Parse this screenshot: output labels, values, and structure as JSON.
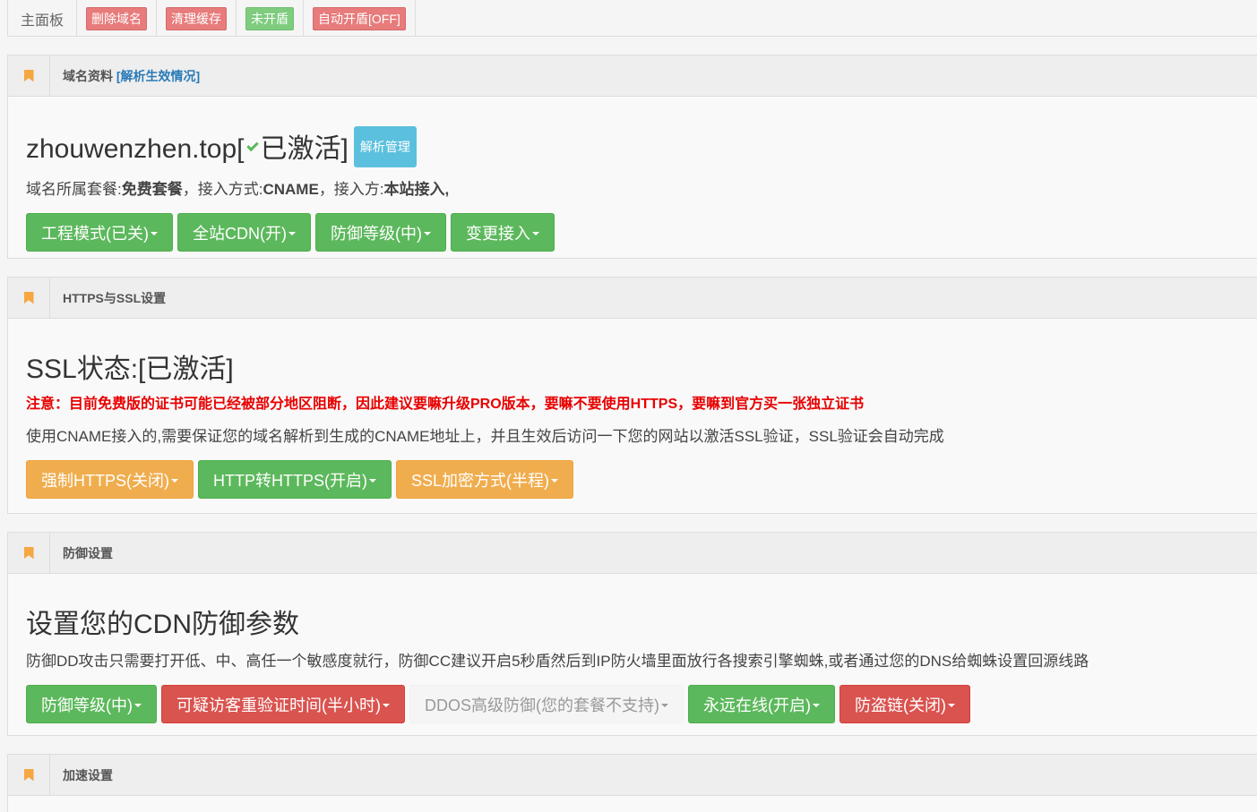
{
  "topbar": {
    "home": "主面板",
    "buttons": [
      {
        "label": "删除域名",
        "color": "red"
      },
      {
        "label": "清理缓存",
        "color": "red"
      },
      {
        "label": "未开盾",
        "color": "green"
      },
      {
        "label": "自动开盾[OFF]",
        "color": "red"
      }
    ]
  },
  "domain_panel": {
    "title": "域名资料",
    "title_link": "[解析生效情况]",
    "domain_prefix": "zhouwenzhen.top[",
    "domain_status": "已激活]",
    "dns_badge": "解析管理",
    "desc_parts": [
      "域名所属套餐:",
      "免费套餐",
      "，接入方式:",
      "CNAME",
      "，接入方:",
      "本站接入,"
    ],
    "buttons": [
      {
        "label": "工程模式(已关)",
        "color": "green"
      },
      {
        "label": "全站CDN(开)",
        "color": "green"
      },
      {
        "label": "防御等级(中)",
        "color": "green"
      },
      {
        "label": "变更接入",
        "color": "green"
      }
    ]
  },
  "ssl_panel": {
    "title": "HTTPS与SSL设置",
    "status": "SSL状态:[已激活]",
    "warning": "注意：目前免费版的证书可能已经被部分地区阻断，因此建议要嘛升级PRO版本，要嘛不要使用HTTPS，要嘛到官方买一张独立证书",
    "desc": "使用CNAME接入的,需要保证您的域名解析到生成的CNAME地址上，并且生效后访问一下您的网站以激活SSL验证，SSL验证会自动完成",
    "buttons": [
      {
        "label": "强制HTTPS(关闭)",
        "color": "orange"
      },
      {
        "label": "HTTP转HTTPS(开启)",
        "color": "green"
      },
      {
        "label": "SSL加密方式(半程)",
        "color": "orange"
      }
    ]
  },
  "defense_panel": {
    "title": "防御设置",
    "heading": "设置您的CDN防御参数",
    "desc": "防御DD攻击只需要打开低、中、高任一个敏感度就行，防御CC建议开启5秒盾然后到IP防火墙里面放行各搜索引擎蜘蛛,或者通过您的DNS给蜘蛛设置回源线路",
    "buttons": [
      {
        "label": "防御等级(中)",
        "color": "green"
      },
      {
        "label": "可疑访客重验证时间(半小时)",
        "color": "red"
      },
      {
        "label": "DDOS高级防御(您的套餐不支持)",
        "color": "disabled"
      },
      {
        "label": "永远在线(开启)",
        "color": "green"
      },
      {
        "label": "防盗链(关闭)",
        "color": "red"
      }
    ]
  },
  "speed_panel": {
    "title": "加速设置"
  }
}
